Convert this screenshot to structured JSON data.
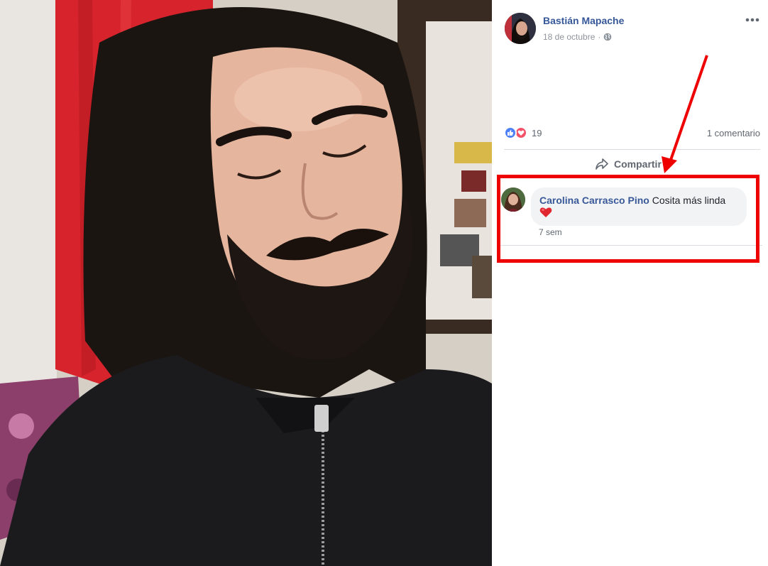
{
  "post": {
    "author": "Bastián Mapache",
    "date": "18 de octubre",
    "separator": "·",
    "privacy_icon": "globe-icon"
  },
  "reactions": {
    "count": "19",
    "types": [
      "like-icon",
      "love-icon"
    ],
    "comments_label": "1 comentario"
  },
  "actions": {
    "share_label": "Compartir"
  },
  "comment": {
    "author": "Carolina Carrasco Pino",
    "text": "Cosita más linda",
    "emoji": "heart-icon",
    "time": "7 sem"
  },
  "colors": {
    "link_blue": "#365899",
    "annotation_red": "#ee0000",
    "like_blue": "#4f82f7",
    "love_red": "#f25268"
  }
}
